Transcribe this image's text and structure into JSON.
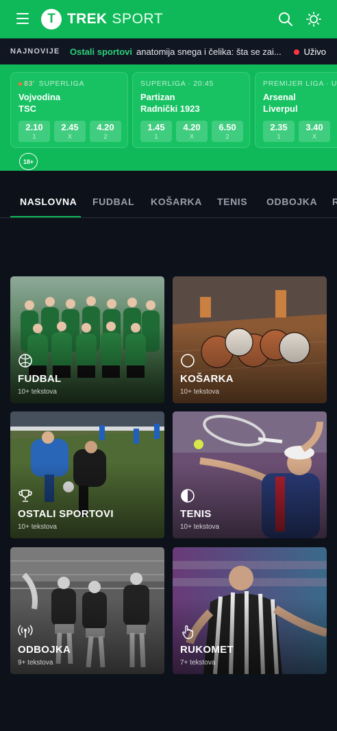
{
  "header": {
    "logo_letter": "T",
    "logo_word1": "TREK",
    "logo_word2": "SPORT",
    "icons": [
      "menu-icon",
      "search-icon",
      "theme-sun-icon"
    ]
  },
  "ticker": {
    "label": "NAJNOVIJE",
    "category": "Ostali sportovi",
    "text": "anatomija snega i čelika: šta se zai...",
    "live_label": "Uživo"
  },
  "matches": [
    {
      "live_minute": "83'",
      "meta": "SUPERLIGA",
      "team1": "Vojvodina",
      "team2": "TSC",
      "odds": [
        {
          "value": "2.10",
          "label": "1"
        },
        {
          "value": "2.45",
          "label": "X"
        },
        {
          "value": "4.20",
          "label": "2"
        }
      ]
    },
    {
      "live_minute": "",
      "meta": "SUPERLIGA · 20:45",
      "team1": "Partizan",
      "team2": "Radnički 1923",
      "odds": [
        {
          "value": "1.45",
          "label": "1"
        },
        {
          "value": "4.20",
          "label": "X"
        },
        {
          "value": "6.50",
          "label": "2"
        }
      ]
    },
    {
      "live_minute": "",
      "meta": "PREMIJER LIGA · U",
      "team1": "Arsenal",
      "team2": "Liverpul",
      "odds": [
        {
          "value": "2.35",
          "label": "1"
        },
        {
          "value": "3.40",
          "label": "X"
        },
        {
          "value": "",
          "label": ""
        }
      ]
    }
  ],
  "age_badge": "18+",
  "tabs": [
    "NASLOVNA",
    "FUDBAL",
    "KOŠARKA",
    "TENIS",
    "ODBOJKA",
    "R"
  ],
  "active_tab": "NASLOVNA",
  "categories": [
    {
      "title": "FUDBAL",
      "count": "10+ tekstova",
      "icon": "football-icon"
    },
    {
      "title": "KOŠARKA",
      "count": "10+ tekstova",
      "icon": "basketball-icon"
    },
    {
      "title": "OSTALI SPORTOVI",
      "count": "10+ tekstova",
      "icon": "trophy-icon"
    },
    {
      "title": "TENIS",
      "count": "10+ tekstova",
      "icon": "tennis-icon"
    },
    {
      "title": "ODBOJKA",
      "count": "9+ tekstova",
      "icon": "broadcast-icon"
    },
    {
      "title": "RUKOMET",
      "count": "7+ tekstova",
      "icon": "hand-icon"
    }
  ],
  "colors": {
    "brand": "#0fb858",
    "background": "#0d111a",
    "live": "#ff3344"
  }
}
